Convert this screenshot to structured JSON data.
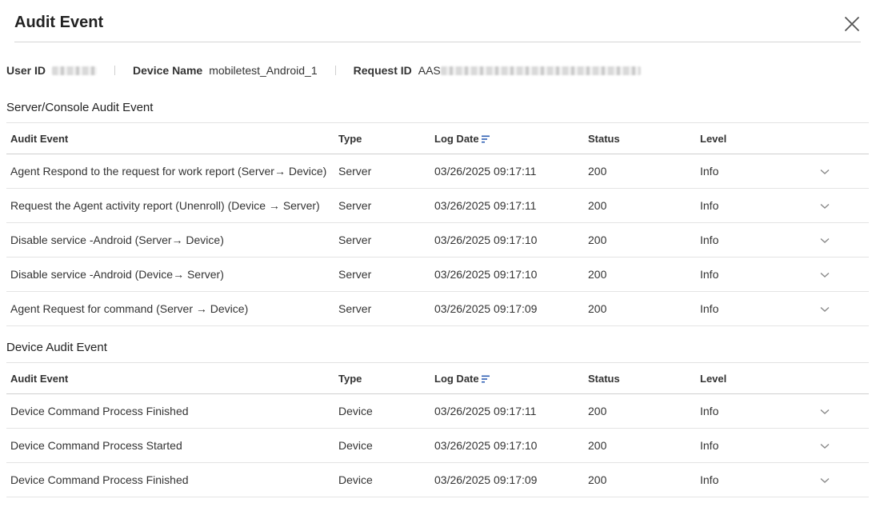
{
  "header": {
    "title": "Audit Event"
  },
  "meta": {
    "user_id_label": "User ID",
    "device_name_label": "Device Name",
    "device_name_value": "mobiletest_Android_1",
    "request_id_label": "Request ID",
    "request_id_prefix": "AAS"
  },
  "columns": {
    "audit_event": "Audit Event",
    "type": "Type",
    "log_date": "Log Date",
    "status": "Status",
    "level": "Level"
  },
  "server_section": {
    "title": "Server/Console Audit Event",
    "rows": [
      {
        "event": "Agent Respond to the request for work report (Server→ Device)",
        "type": "Server",
        "date": "03/26/2025 09:17:11",
        "status": "200",
        "level": "Info"
      },
      {
        "event": "Request the Agent activity report (Unenroll) (Device → Server)",
        "type": "Server",
        "date": "03/26/2025 09:17:11",
        "status": "200",
        "level": "Info"
      },
      {
        "event": "Disable service -Android (Server→ Device)",
        "type": "Server",
        "date": "03/26/2025 09:17:10",
        "status": "200",
        "level": "Info"
      },
      {
        "event": "Disable service -Android (Device→ Server)",
        "type": "Server",
        "date": "03/26/2025 09:17:10",
        "status": "200",
        "level": "Info"
      },
      {
        "event": "Agent Request for command (Server → Device)",
        "type": "Server",
        "date": "03/26/2025 09:17:09",
        "status": "200",
        "level": "Info"
      }
    ]
  },
  "device_section": {
    "title": "Device Audit Event",
    "rows": [
      {
        "event": "Device Command Process Finished",
        "type": "Device",
        "date": "03/26/2025 09:17:11",
        "status": "200",
        "level": "Info"
      },
      {
        "event": "Device Command Process Started",
        "type": "Device",
        "date": "03/26/2025 09:17:10",
        "status": "200",
        "level": "Info"
      },
      {
        "event": "Device Command Process Finished",
        "type": "Device",
        "date": "03/26/2025 09:17:09",
        "status": "200",
        "level": "Info"
      }
    ]
  },
  "icons": {
    "close": "close-icon",
    "sort": "sort-desc-icon",
    "expand": "chevron-down-icon"
  },
  "colors": {
    "sort_accent": "#2f5fb3",
    "chevron": "#8a8a8a",
    "divider": "#d6d6d6"
  }
}
